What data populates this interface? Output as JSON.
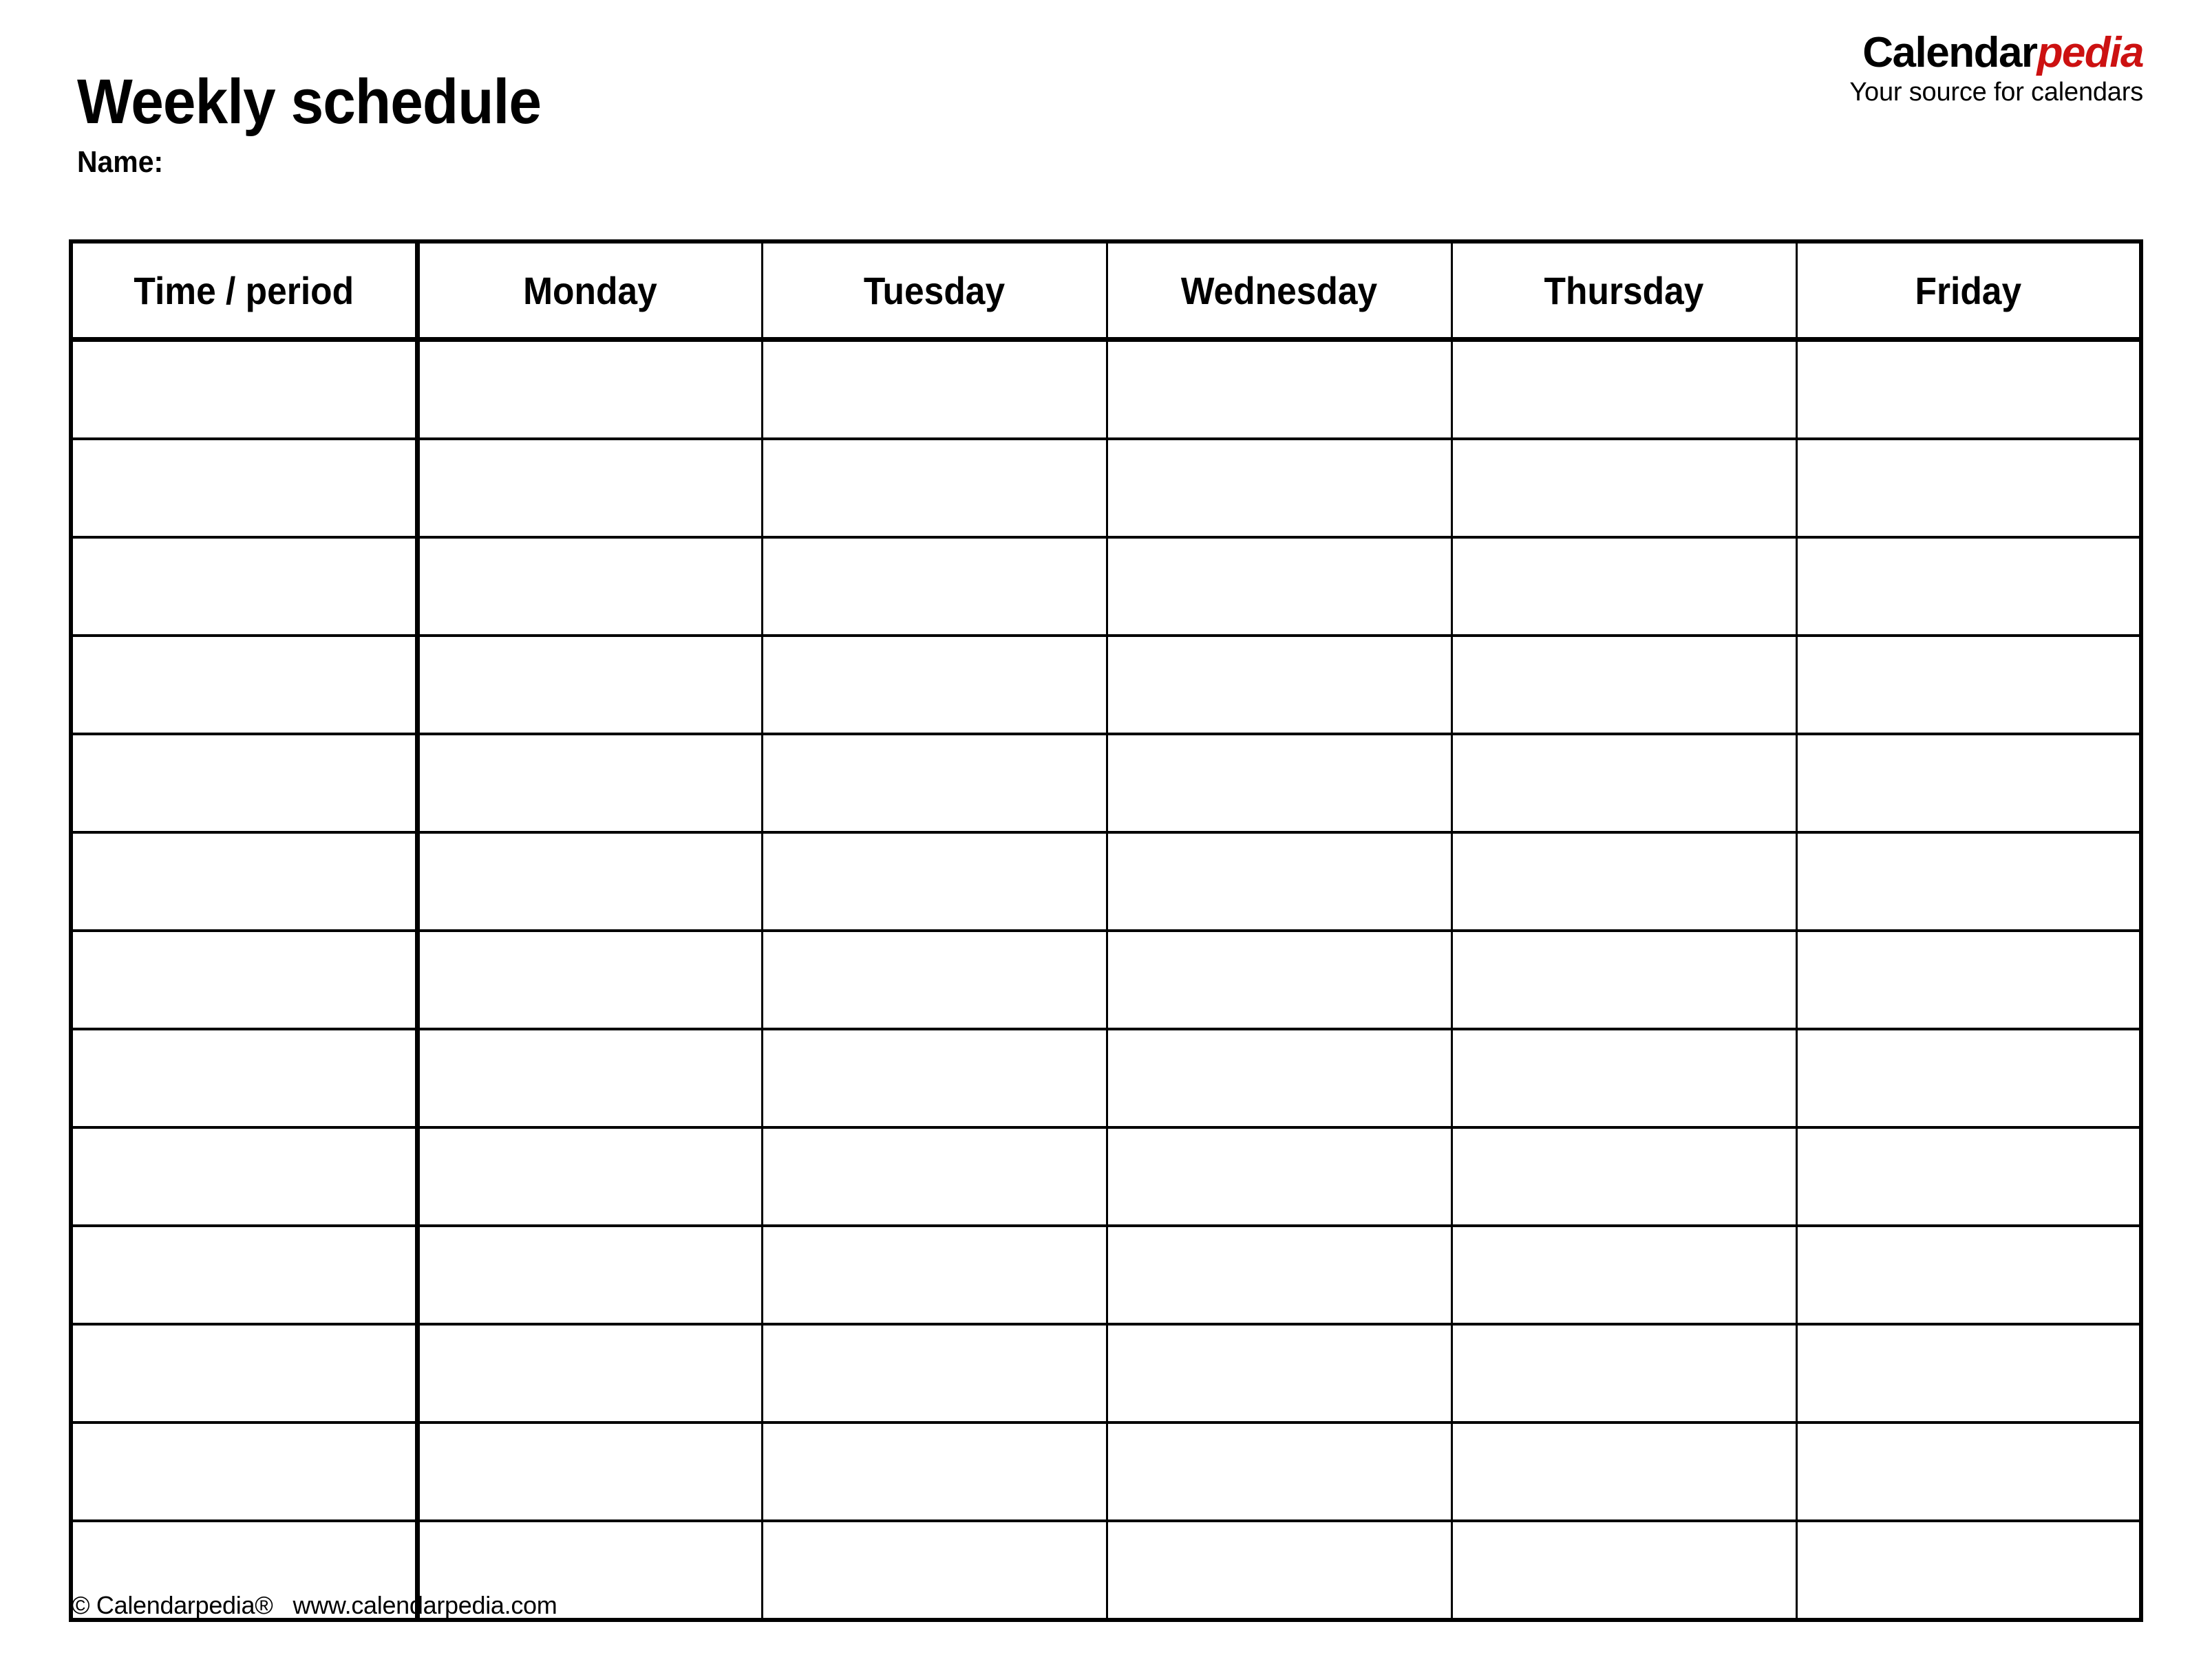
{
  "header": {
    "title": "Weekly schedule",
    "name_label": "Name:"
  },
  "brand": {
    "word_primary": "Calendar",
    "word_accent": "pedia",
    "tagline": "Your source for calendars",
    "accent_color": "#CC1111",
    "primary_color": "#000000"
  },
  "table": {
    "columns": [
      "Time / period",
      "Monday",
      "Tuesday",
      "Wednesday",
      "Thursday",
      "Friday"
    ],
    "row_count": 13,
    "rows": [
      [
        "",
        "",
        "",
        "",
        "",
        ""
      ],
      [
        "",
        "",
        "",
        "",
        "",
        ""
      ],
      [
        "",
        "",
        "",
        "",
        "",
        ""
      ],
      [
        "",
        "",
        "",
        "",
        "",
        ""
      ],
      [
        "",
        "",
        "",
        "",
        "",
        ""
      ],
      [
        "",
        "",
        "",
        "",
        "",
        ""
      ],
      [
        "",
        "",
        "",
        "",
        "",
        ""
      ],
      [
        "",
        "",
        "",
        "",
        "",
        ""
      ],
      [
        "",
        "",
        "",
        "",
        "",
        ""
      ],
      [
        "",
        "",
        "",
        "",
        "",
        ""
      ],
      [
        "",
        "",
        "",
        "",
        "",
        ""
      ],
      [
        "",
        "",
        "",
        "",
        "",
        ""
      ],
      [
        "",
        "",
        "",
        "",
        "",
        ""
      ]
    ]
  },
  "footer": {
    "text": "© Calendarpedia®   www.calendarpedia.com"
  }
}
